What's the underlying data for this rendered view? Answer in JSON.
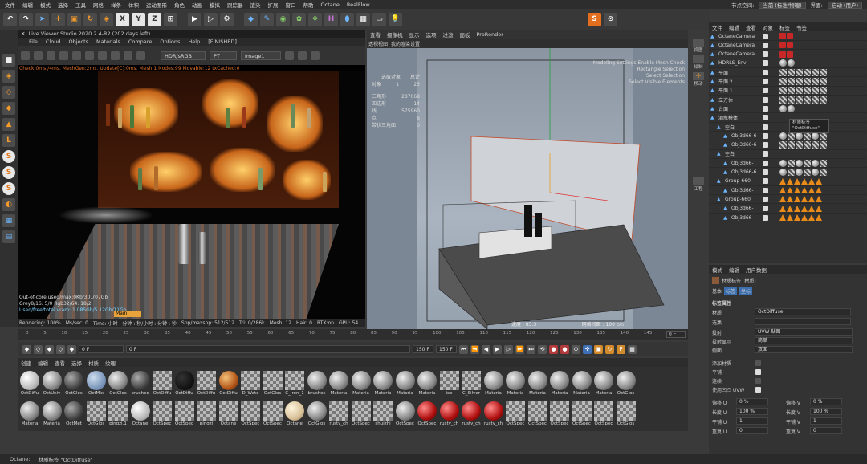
{
  "menubar": {
    "items": [
      "文件",
      "编辑",
      "模式",
      "选择",
      "工具",
      "网格",
      "样条",
      "体积",
      "运动图形",
      "角色",
      "动画",
      "模拟",
      "跟踪器",
      "渲染",
      "扩展",
      "窗口",
      "帮助",
      "Octane",
      "RealFlow"
    ],
    "node_space_label": "节点空间:",
    "node_space_value": "当前 (标准/物理)",
    "layout_label": "界面:",
    "layout_value": "启动 (用户)"
  },
  "toolbar": {
    "icons": [
      "undo-icon",
      "redo-icon",
      "move-icon",
      "scale-icon",
      "rotate-icon",
      "x-axis-icon",
      "y-axis-icon",
      "z-axis-icon",
      "coordinate-icon",
      "play-render-icon",
      "render-icon",
      "render-settings-icon",
      "cube-icon",
      "pen-icon",
      "subdivision-icon",
      "array-icon",
      "deformer-icon",
      "field-icon",
      "camera-icon",
      "light-icon"
    ],
    "axis_labels": [
      "X",
      "Y",
      "Z"
    ]
  },
  "liveviewer": {
    "title": "Live Viewer Studio 2020.2.4-R2 (202 days left)",
    "menu": [
      "File",
      "Cloud",
      "Objects",
      "Materials",
      "Compare",
      "Options",
      "Help",
      "[FINISHED]"
    ],
    "colorspace": "HDR/sRGB",
    "kernel": "PT",
    "buffer": "Image1",
    "status_line": "Check:0ms./4ms. MeshGen:2ms. Update[C]:0ms. Mesh:1 Nodes:99 Movable:12 txCached:0",
    "info_lines": [
      "Out-of-core used/max:0Kb/30.707Gb",
      "Grey8/16: 5/0        Rgb32/64: 18/2",
      "Used/free/total vram: 1.085Gb/5.12Gb/11Gb"
    ],
    "main_label": "Main",
    "bottom": [
      "Rendering: 100%",
      "Ms/sec: 0",
      "Time: 小时 : 分钟 : 秒/小时 : 分钟 : 秒",
      "Spp/maxspp: 512/512",
      "Tri: 0/286k",
      "Mesh: 12",
      "Hair: 0",
      "RTX:on",
      "GPU: 54"
    ]
  },
  "viewport": {
    "menu": [
      "查看",
      "摄像机",
      "显示",
      "选项",
      "过滤",
      "面板",
      "ProRender"
    ],
    "sub": [
      "透视视图",
      "我的渲染设置"
    ],
    "hint_lines": [
      "Modeling Settings Enable Mesh Check",
      "Rectangle Selection",
      "Select Selection",
      "Select Visible Elements"
    ],
    "stats_title": [
      "选取对象",
      "总计"
    ],
    "stats": [
      [
        "对象",
        "1",
        "23"
      ],
      [
        "三角形",
        "",
        "287068"
      ],
      [
        "四边形",
        "",
        "14"
      ],
      [
        "线",
        "",
        "575960"
      ],
      [
        "点",
        "",
        "6"
      ],
      [
        "带状三角面",
        "",
        "0"
      ]
    ],
    "speed": "速度 : 83.3",
    "grid": "网格间距 : 100 cm"
  },
  "side_icons": [
    "视图",
    "绘制",
    "移动",
    "工程"
  ],
  "objects": {
    "tabs": [
      "文件",
      "编辑",
      "查看",
      "对象",
      "标签",
      "书签"
    ],
    "rows": [
      {
        "name": "OctaneCamera",
        "indent": 8,
        "tags": "red"
      },
      {
        "name": "OctaneCamera",
        "indent": 8,
        "tags": "red"
      },
      {
        "name": "OctaneCamera",
        "indent": 8,
        "tags": "red"
      },
      {
        "name": "HDRLS_Env",
        "indent": 8,
        "tags": "ball"
      },
      {
        "name": "平面",
        "indent": 8,
        "tags": "sq"
      },
      {
        "name": "平面.2",
        "indent": 8,
        "tags": "sq"
      },
      {
        "name": "平面.1",
        "indent": 8,
        "tags": "sq"
      },
      {
        "name": "立方体",
        "indent": 8,
        "tags": "sq"
      },
      {
        "name": "台面",
        "indent": 8,
        "tags": "ball"
      },
      {
        "name": "酒瓶模体",
        "indent": 8,
        "tags": "none"
      },
      {
        "name": "空白",
        "indent": 16,
        "tags": "none"
      },
      {
        "name": "Obj3d66-6",
        "indent": 24,
        "tags": "mix"
      },
      {
        "name": "Obj3d66-6",
        "indent": 24,
        "tags": "sq"
      },
      {
        "name": "空白",
        "indent": 16,
        "tags": "none"
      },
      {
        "name": "Obj3d66-",
        "indent": 24,
        "tags": "mix"
      },
      {
        "name": "Obj3d66-6",
        "indent": 24,
        "tags": "mix"
      },
      {
        "name": "Group-660",
        "indent": 16,
        "tags": "tri"
      },
      {
        "name": "Obj3d66-",
        "indent": 24,
        "tags": "tri"
      },
      {
        "name": "Group-660",
        "indent": 16,
        "tags": "tri"
      },
      {
        "name": "Obj3d66-",
        "indent": 24,
        "tags": "tri"
      },
      {
        "name": "Obj3d66-",
        "indent": 24,
        "tags": "tri"
      }
    ],
    "tooltip": [
      "材质标签",
      "\"OctDiffuse\""
    ]
  },
  "attributes": {
    "tabs": [
      "模式",
      "编辑",
      "用户数据"
    ],
    "header": "材质标签 [材质]",
    "subtabs": [
      "基本",
      "标签",
      "坐标"
    ],
    "section": "标签属性",
    "material_label": "材质",
    "material_value": "OctDiffuse",
    "selection_label": "选集",
    "projection_label": "投射",
    "projection_value": "UVW 贴图",
    "projection_display_label": "投射显示",
    "projection_display_value": "简单",
    "side_label": "侧面",
    "side_value": "双面",
    "add_material_label": "添加材质",
    "tile_label": "平铺",
    "continuous_label": "连续",
    "use_uvw_label": "使用凹凸 UVW",
    "offset_u_label": "偏移 U",
    "offset_u": "0 %",
    "offset_v_label": "偏移 V",
    "offset_v": "0 %",
    "length_u_label": "长度 U",
    "length_u": "100 %",
    "length_v_label": "长度 V",
    "length_v": "100 %",
    "tile_u_label": "平铺 U",
    "tile_u": "1",
    "tile_v_label": "平铺 V",
    "tile_v": "1",
    "repeat_u_label": "重复 U",
    "repeat_u": "0",
    "repeat_v_label": "重复 V",
    "repeat_v": "0"
  },
  "timeline": {
    "marks": [
      "0",
      "5",
      "10",
      "15",
      "20",
      "25",
      "30",
      "35",
      "40",
      "45",
      "50",
      "55",
      "60",
      "65",
      "70",
      "75",
      "80",
      "85",
      "90",
      "95",
      "100",
      "105",
      "110",
      "115",
      "120",
      "125",
      "130",
      "135",
      "140",
      "145",
      "150"
    ],
    "end_label": "0 F"
  },
  "playbar": {
    "start": "0 F",
    "current": "0 F",
    "end": "150 F",
    "end2": "150 F"
  },
  "materials": {
    "menu": [
      "创建",
      "编辑",
      "查看",
      "选择",
      "材质",
      "纹理"
    ],
    "row1": [
      {
        "label": "OctDiffu",
        "style": "white"
      },
      {
        "label": "OctUniv",
        "style": "grey"
      },
      {
        "label": "OctGlos",
        "style": "dark"
      },
      {
        "label": "OctMix",
        "style": "mix"
      },
      {
        "label": "OctGlos",
        "style": "grey"
      },
      {
        "label": "brushec",
        "style": "dark"
      },
      {
        "label": "OctDiffu",
        "style": "chk"
      },
      {
        "label": "OctDiffu",
        "style": "black"
      },
      {
        "label": "OctDiffu",
        "style": "chk"
      },
      {
        "label": "OctDiffu",
        "style": "orange"
      },
      {
        "label": "D_Wate",
        "style": "chk"
      },
      {
        "label": "OctGlos",
        "style": "chk"
      },
      {
        "label": "C_Iron_1",
        "style": "chk"
      },
      {
        "label": "brushes",
        "style": "grey"
      },
      {
        "label": "Materia",
        "style": "grey"
      },
      {
        "label": "Materia",
        "style": "grey"
      },
      {
        "label": "Materia",
        "style": "grey"
      },
      {
        "label": "Materia",
        "style": "grey"
      },
      {
        "label": "Materia",
        "style": "grey"
      },
      {
        "label": "ice",
        "style": "chk"
      },
      {
        "label": "C_Silver",
        "style": "chk"
      },
      {
        "label": "Materia",
        "style": "grey"
      },
      {
        "label": "Materia",
        "style": "grey"
      },
      {
        "label": "Materia",
        "style": "grey"
      },
      {
        "label": "Materia",
        "style": "grey"
      },
      {
        "label": "Materia",
        "style": "grey"
      },
      {
        "label": "Materia",
        "style": "grey"
      },
      {
        "label": "OctGlos",
        "style": "grey"
      }
    ],
    "row2": [
      {
        "label": "Materia",
        "style": "grey"
      },
      {
        "label": "Materia",
        "style": "grey"
      },
      {
        "label": "OctMet",
        "style": "dark"
      },
      {
        "label": "OctGlos",
        "style": "chk"
      },
      {
        "label": "pingzi.1",
        "style": "chk"
      },
      {
        "label": "Octane",
        "style": "white"
      },
      {
        "label": "OctSpec",
        "style": "chk"
      },
      {
        "label": "OctSpec",
        "style": "chk"
      },
      {
        "label": "pingzi",
        "style": "chk"
      },
      {
        "label": "Octane",
        "style": "chk"
      },
      {
        "label": "OctSpec",
        "style": "chk"
      },
      {
        "label": "OctSpec",
        "style": "chk"
      },
      {
        "label": "Octane",
        "style": "cream"
      },
      {
        "label": "OctGlos",
        "style": "grey"
      },
      {
        "label": "rusty_ch",
        "style": "chk"
      },
      {
        "label": "OctSpec",
        "style": "chk"
      },
      {
        "label": "shuizhi",
        "style": "chk"
      },
      {
        "label": "OctSpec",
        "style": "grey"
      },
      {
        "label": "OctSpec",
        "style": "red"
      },
      {
        "label": "rusty_ch",
        "style": "red"
      },
      {
        "label": "rusty_ch",
        "style": "red"
      },
      {
        "label": "rusty_ch",
        "style": "red"
      },
      {
        "label": "OctSpec",
        "style": "chk"
      },
      {
        "label": "OctSpec",
        "style": "chk"
      },
      {
        "label": "OctSpec",
        "style": "chk"
      },
      {
        "label": "OctSpec",
        "style": "chk"
      },
      {
        "label": "OctSpec",
        "style": "chk"
      },
      {
        "label": "OctGlos",
        "style": "chk"
      }
    ]
  },
  "status": {
    "left": "Octane:",
    "msg": "材质标签 \"OctDiffuse\""
  }
}
